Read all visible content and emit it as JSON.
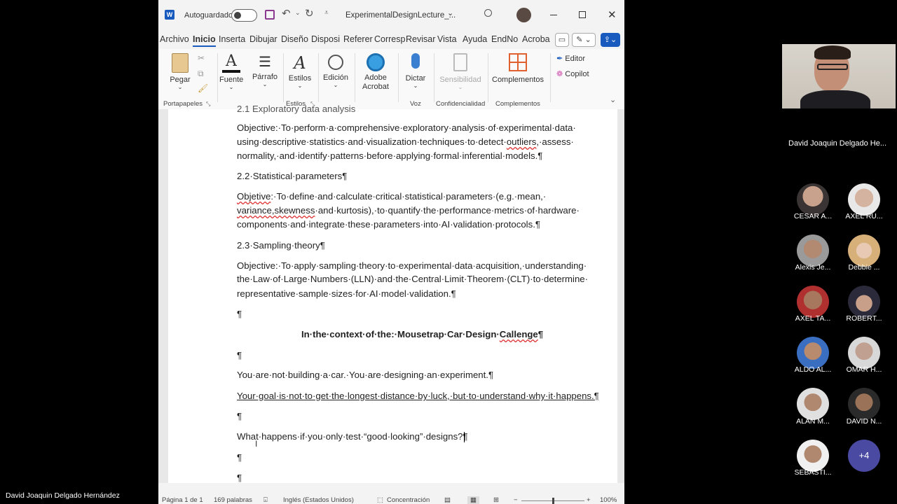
{
  "window": {
    "autosave_label": "Autoguardado",
    "file_name": "ExperimentalDesignLecture_..."
  },
  "menu_tabs": [
    "Archivo",
    "Inicio",
    "Insertar",
    "Dibujar",
    "Diseño",
    "Disposición",
    "Referencias",
    "Correspondencia",
    "Revisar",
    "Vista",
    "Ayuda",
    "EndNote",
    "Acrobat"
  ],
  "menu_display": [
    "Archivo",
    "Inicio",
    "Inserta",
    "Dibujar",
    "Diseño",
    "Disposi",
    "Referer",
    "Corresp",
    "Revisar",
    "Vista",
    "Ayuda",
    "EndNo",
    "Acroba"
  ],
  "ribbon": {
    "paste": "Pegar",
    "font": "Fuente",
    "paragraph": "Párrafo",
    "styles": "Estilos",
    "editing": "Edición",
    "adobe": "Adobe Acrobat",
    "dictate": "Dictar",
    "sensitivity": "Sensibilidad",
    "addins": "Complementos",
    "editor": "Editor",
    "copilot": "Copilot",
    "groups": {
      "clipboard": "Portapapeles",
      "styles": "Estilos",
      "voice": "Voz",
      "confidentiality": "Confidencialidad",
      "addins": "Complementos"
    }
  },
  "document": {
    "cut_heading": "2.1 Exploratory data analysis",
    "p1": [
      "Objective:·To·perform·a·comprehensive·exploratory·analysis·of·experimental·data·",
      "using·descriptive·statistics·and·visualization·techniques·to·detect·",
      "outliers",
      ",·assess·",
      "normality,·and·identify·patterns·before·applying·formal·inferential·models.¶"
    ],
    "h2": "2.2·Statistical·parameters¶",
    "p2a": "Objetive",
    "p2b": ":·To·define·and·calculate·critical·statistical·parameters·(e.g.·mean,·",
    "p2c": "variance,skewness",
    "p2d": "·and·kurtosis),·to·quantify·the·performance·metrics·of·hardware·",
    "p2e": "components·and·integrate·these·parameters·into·AI·validation·protocols.¶",
    "h3": "2.3·Sampling·theory¶",
    "p3": [
      "Objective:·To·apply·sampling·theory·to·experimental·data·acquisition,·understanding·",
      "the·Law·of·Large·Numbers·(LLN)·and·the·Central·Limit·Theorem·(CLT)·to·determine·",
      "representative·sample·sizes·for·AI·model·validation.¶"
    ],
    "pilcrow": "¶",
    "center_heading_a": "In·the·context·of·the:·Mousetrap·Car·Design·",
    "center_heading_b": "Callenge",
    "center_heading_c": "¶",
    "line_a": "You·are·not·building·a·car.·You·are·designing·an·experiment.¶",
    "line_b": "Your·goal·is·not·to·get·the·longest·distance·by·luck,·but·to·understand·why·it·happens.¶",
    "line_c": "What·happens·if·you·only·test·“good·looking”·designs?¶"
  },
  "status": {
    "page": "Página 1 de 1",
    "words": "169 palabras",
    "language": "Inglés (Estados Unidos)",
    "focus": "Concentración",
    "zoom": "100%"
  },
  "meeting": {
    "presenter_label": "David Joaquin Delgado Hernández",
    "speaker_label": "David Joaquin Delgado He...",
    "participants": [
      "CESAR A...",
      "AXEL RU...",
      "Alexis Je...",
      "Debbie ...",
      "AXEL TA...",
      "ROBERT...",
      "ALDO AL...",
      "OMAR H...",
      "ALAN M...",
      "DAVID N...",
      "SEBASTI..."
    ],
    "more": "+4"
  },
  "colors": {
    "word_blue": "#185abd",
    "accent": "#2b579a",
    "more_button": "#4a4aa3"
  }
}
